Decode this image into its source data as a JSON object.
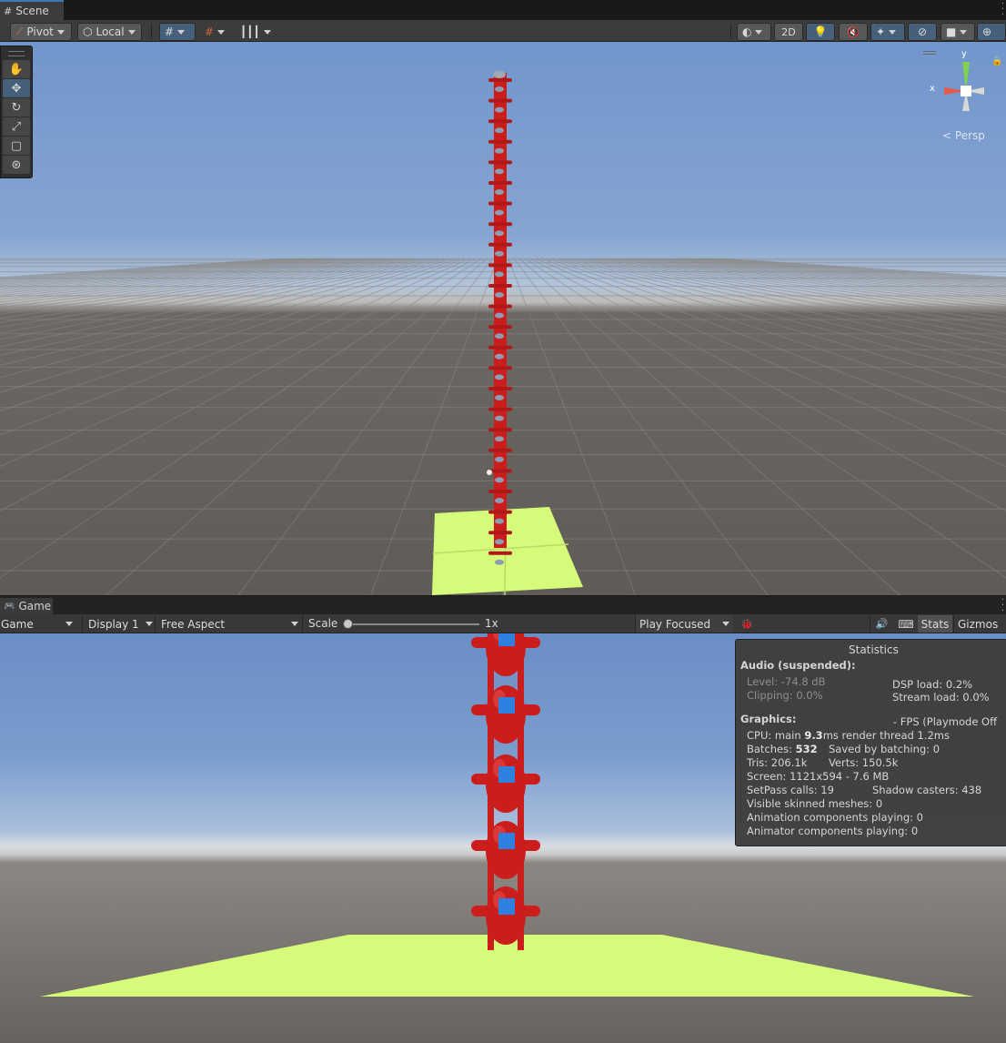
{
  "scene_tab": {
    "label": "Scene"
  },
  "scene_toolbar": {
    "pivot": "Pivot",
    "local": "Local",
    "mode_2d": "2D"
  },
  "scene_view": {
    "projection": "Persp",
    "axis_x": "x",
    "axis_y": "y"
  },
  "game_tab": {
    "label": "Game"
  },
  "game_toolbar": {
    "view": "Game",
    "display": "Display 1",
    "aspect": "Free Aspect",
    "scale_label": "Scale",
    "scale_value": "1x",
    "play_mode": "Play Focused",
    "stats": "Stats",
    "gizmos": "Gizmos"
  },
  "statistics": {
    "title": "Statistics",
    "audio_header": "Audio (suspended):",
    "level": "Level: -74.8 dB",
    "clipping": "Clipping: 0.0%",
    "dsp_load": "DSP load: 0.2%",
    "stream_load": "Stream load: 0.0%",
    "graphics_header": "Graphics:",
    "fps": "- FPS (Playmode Off",
    "cpu_pre": "CPU: main ",
    "cpu_main": "9.3",
    "cpu_post": "ms  render thread 1.2ms",
    "batches_pre": "Batches: ",
    "batches": "532",
    "saved_batching": "Saved by batching: 0",
    "tris": "Tris: 206.1k",
    "verts": "Verts: 150.5k",
    "screen": "Screen: 1121x594 - 7.6 MB",
    "setpass": "SetPass calls: 19",
    "shadow_casters": "Shadow casters: 438",
    "visible_skinned": "Visible skinned meshes: 0",
    "animation_components": "Animation components playing: 0",
    "animator_components": "Animator components playing: 0"
  },
  "colors": {
    "accent": "#3a79bb",
    "robot_red": "#cc1d1d",
    "robot_blue": "#2f80df",
    "ground_green": "#d6fb7a"
  }
}
